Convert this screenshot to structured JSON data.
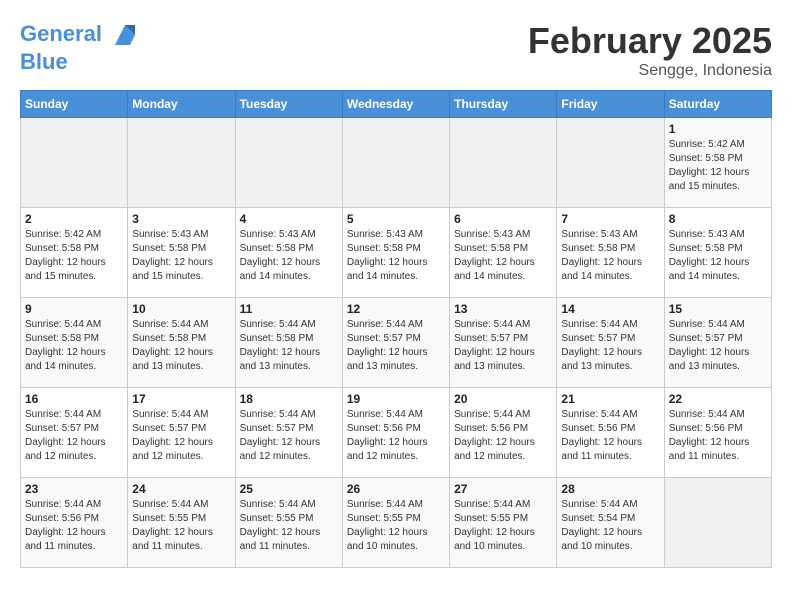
{
  "header": {
    "logo_line1": "General",
    "logo_line2": "Blue",
    "month": "February 2025",
    "location": "Sengge, Indonesia"
  },
  "days_of_week": [
    "Sunday",
    "Monday",
    "Tuesday",
    "Wednesday",
    "Thursday",
    "Friday",
    "Saturday"
  ],
  "weeks": [
    [
      {
        "day": "",
        "info": ""
      },
      {
        "day": "",
        "info": ""
      },
      {
        "day": "",
        "info": ""
      },
      {
        "day": "",
        "info": ""
      },
      {
        "day": "",
        "info": ""
      },
      {
        "day": "",
        "info": ""
      },
      {
        "day": "1",
        "info": "Sunrise: 5:42 AM\nSunset: 5:58 PM\nDaylight: 12 hours\nand 15 minutes."
      }
    ],
    [
      {
        "day": "2",
        "info": "Sunrise: 5:42 AM\nSunset: 5:58 PM\nDaylight: 12 hours\nand 15 minutes."
      },
      {
        "day": "3",
        "info": "Sunrise: 5:43 AM\nSunset: 5:58 PM\nDaylight: 12 hours\nand 15 minutes."
      },
      {
        "day": "4",
        "info": "Sunrise: 5:43 AM\nSunset: 5:58 PM\nDaylight: 12 hours\nand 14 minutes."
      },
      {
        "day": "5",
        "info": "Sunrise: 5:43 AM\nSunset: 5:58 PM\nDaylight: 12 hours\nand 14 minutes."
      },
      {
        "day": "6",
        "info": "Sunrise: 5:43 AM\nSunset: 5:58 PM\nDaylight: 12 hours\nand 14 minutes."
      },
      {
        "day": "7",
        "info": "Sunrise: 5:43 AM\nSunset: 5:58 PM\nDaylight: 12 hours\nand 14 minutes."
      },
      {
        "day": "8",
        "info": "Sunrise: 5:43 AM\nSunset: 5:58 PM\nDaylight: 12 hours\nand 14 minutes."
      }
    ],
    [
      {
        "day": "9",
        "info": "Sunrise: 5:44 AM\nSunset: 5:58 PM\nDaylight: 12 hours\nand 14 minutes."
      },
      {
        "day": "10",
        "info": "Sunrise: 5:44 AM\nSunset: 5:58 PM\nDaylight: 12 hours\nand 13 minutes."
      },
      {
        "day": "11",
        "info": "Sunrise: 5:44 AM\nSunset: 5:58 PM\nDaylight: 12 hours\nand 13 minutes."
      },
      {
        "day": "12",
        "info": "Sunrise: 5:44 AM\nSunset: 5:57 PM\nDaylight: 12 hours\nand 13 minutes."
      },
      {
        "day": "13",
        "info": "Sunrise: 5:44 AM\nSunset: 5:57 PM\nDaylight: 12 hours\nand 13 minutes."
      },
      {
        "day": "14",
        "info": "Sunrise: 5:44 AM\nSunset: 5:57 PM\nDaylight: 12 hours\nand 13 minutes."
      },
      {
        "day": "15",
        "info": "Sunrise: 5:44 AM\nSunset: 5:57 PM\nDaylight: 12 hours\nand 13 minutes."
      }
    ],
    [
      {
        "day": "16",
        "info": "Sunrise: 5:44 AM\nSunset: 5:57 PM\nDaylight: 12 hours\nand 12 minutes."
      },
      {
        "day": "17",
        "info": "Sunrise: 5:44 AM\nSunset: 5:57 PM\nDaylight: 12 hours\nand 12 minutes."
      },
      {
        "day": "18",
        "info": "Sunrise: 5:44 AM\nSunset: 5:57 PM\nDaylight: 12 hours\nand 12 minutes."
      },
      {
        "day": "19",
        "info": "Sunrise: 5:44 AM\nSunset: 5:56 PM\nDaylight: 12 hours\nand 12 minutes."
      },
      {
        "day": "20",
        "info": "Sunrise: 5:44 AM\nSunset: 5:56 PM\nDaylight: 12 hours\nand 12 minutes."
      },
      {
        "day": "21",
        "info": "Sunrise: 5:44 AM\nSunset: 5:56 PM\nDaylight: 12 hours\nand 11 minutes."
      },
      {
        "day": "22",
        "info": "Sunrise: 5:44 AM\nSunset: 5:56 PM\nDaylight: 12 hours\nand 11 minutes."
      }
    ],
    [
      {
        "day": "23",
        "info": "Sunrise: 5:44 AM\nSunset: 5:56 PM\nDaylight: 12 hours\nand 11 minutes."
      },
      {
        "day": "24",
        "info": "Sunrise: 5:44 AM\nSunset: 5:55 PM\nDaylight: 12 hours\nand 11 minutes."
      },
      {
        "day": "25",
        "info": "Sunrise: 5:44 AM\nSunset: 5:55 PM\nDaylight: 12 hours\nand 11 minutes."
      },
      {
        "day": "26",
        "info": "Sunrise: 5:44 AM\nSunset: 5:55 PM\nDaylight: 12 hours\nand 10 minutes."
      },
      {
        "day": "27",
        "info": "Sunrise: 5:44 AM\nSunset: 5:55 PM\nDaylight: 12 hours\nand 10 minutes."
      },
      {
        "day": "28",
        "info": "Sunrise: 5:44 AM\nSunset: 5:54 PM\nDaylight: 12 hours\nand 10 minutes."
      },
      {
        "day": "",
        "info": ""
      }
    ]
  ]
}
